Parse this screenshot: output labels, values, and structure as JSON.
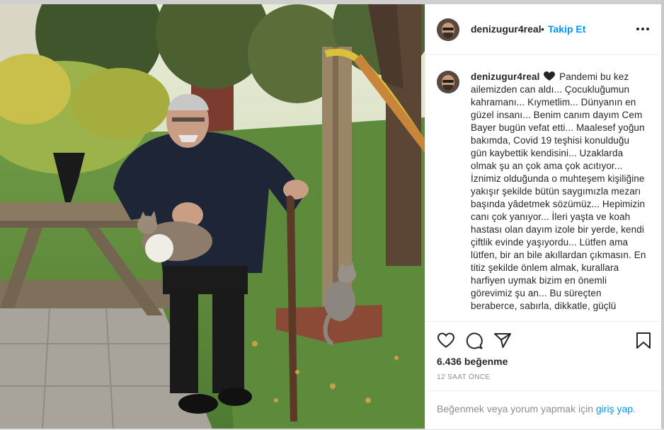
{
  "post": {
    "username": "denizugur4real",
    "separator": "•",
    "follow_label": "Takip Et",
    "more_icon": "more-horizontal-icon",
    "caption": {
      "username": "denizugur4real",
      "emoji": "black-heart",
      "text": "Pandemi bu kez ailemizden can aldı... Çocukluğumun kahramanı... Kıymetlim... Dünyanın en güzel insanı... Benim canım dayım Cem Bayer bugün vefat etti... Maalesef yoğun bakımda, Covid 19 teşhisi konulduğu gün kaybettik kendisini... Uzaklarda olmak şu an çok ama çok acıtıyor... İznimiz olduğunda o muhteşem kişiliğine yakışır şekilde bütün saygımızla mezarı başında yâdetmek sözümüz... Hepimizin canı çok yanıyor... İleri yaşta ve koah hastası olan dayım izole bir yerde, kendi çiftlik evinde yaşıyordu... Lütfen ama lütfen, bir an bile akıllardan çıkmasın. En titiz şekilde önlem almak, kurallara harfiyen uymak bizim en önemli görevimiz şu an... Bu süreçten beraberce, sabırla, dikkatle, güçlü"
    },
    "actions": {
      "like_icon": "heart-icon",
      "comment_icon": "comment-icon",
      "share_icon": "send-icon",
      "save_icon": "bookmark-icon"
    },
    "likes_text": "6.436 beğenme",
    "time_ago": "12 SAAT ÖNCE",
    "login_prompt": {
      "text": "Beğenmek veya yorum yapmak için",
      "link": "giriş yap",
      "suffix": "."
    }
  },
  "colors": {
    "accent": "#0095f6",
    "text": "#262626",
    "muted": "#8e8e8e"
  }
}
